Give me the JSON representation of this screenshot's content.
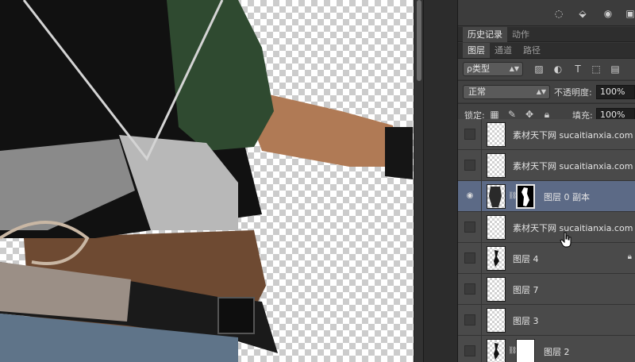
{
  "panel": {
    "history_tabs": [
      {
        "label": "历史记录",
        "active": true
      },
      {
        "label": "动作",
        "active": false
      }
    ],
    "layer_tabs": [
      {
        "label": "图层",
        "active": true
      },
      {
        "label": "通道",
        "active": false
      },
      {
        "label": "路径",
        "active": false
      }
    ],
    "filter": {
      "kind_value": "ρ类型"
    },
    "filter_icons": [
      "image-filter-icon",
      "adjustment-filter-icon",
      "type-filter-icon",
      "shape-filter-icon",
      "smart-object-filter-icon"
    ],
    "blend": {
      "mode_value": "正常",
      "opacity_label": "不透明度:",
      "opacity_value": "100%"
    },
    "lock": {
      "label": "锁定:",
      "fill_label": "填充:",
      "fill_value": "100%"
    },
    "layers": [
      {
        "name": "素材天下网 sucaitianxia.com",
        "visible": false,
        "selected": false,
        "has_mask": false,
        "locked": false
      },
      {
        "name": "素材天下网 sucaitianxia.com",
        "visible": false,
        "selected": false,
        "has_mask": false,
        "locked": false
      },
      {
        "name": "图层 0 副本",
        "visible": true,
        "selected": true,
        "has_mask": true,
        "locked": false
      },
      {
        "name": "素材天下网 sucaitianxia.com",
        "visible": false,
        "selected": false,
        "has_mask": false,
        "locked": false
      },
      {
        "name": "图层 4",
        "visible": false,
        "selected": false,
        "has_mask": false,
        "locked": true
      },
      {
        "name": "图层 7",
        "visible": false,
        "selected": false,
        "has_mask": false,
        "locked": false
      },
      {
        "name": "图层 3",
        "visible": false,
        "selected": false,
        "has_mask": false,
        "locked": false
      },
      {
        "name": "图层 2",
        "visible": false,
        "selected": false,
        "has_mask": true,
        "locked": false
      }
    ]
  },
  "colors": {
    "selected_row": "#5c6a86",
    "panel_bg": "#383838",
    "canvas_check": "#cccccc"
  }
}
